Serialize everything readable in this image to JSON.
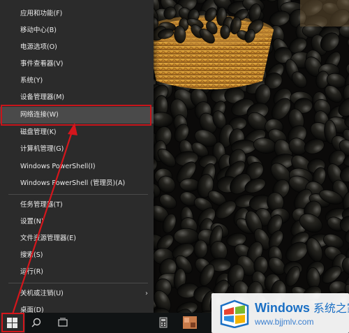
{
  "menu": {
    "items": [
      {
        "label": "应用和功能(F)"
      },
      {
        "label": "移动中心(B)"
      },
      {
        "label": "电源选项(O)"
      },
      {
        "label": "事件查看器(V)"
      },
      {
        "label": "系统(Y)"
      },
      {
        "label": "设备管理器(M)"
      },
      {
        "label": "网络连接(W)",
        "highlighted": true
      },
      {
        "label": "磁盘管理(K)"
      },
      {
        "label": "计算机管理(G)"
      },
      {
        "label": "Windows PowerShell(I)"
      },
      {
        "label": "Windows PowerShell (管理员)(A)"
      },
      {
        "label": "任务管理器(T)"
      },
      {
        "label": "设置(N)"
      },
      {
        "label": "文件资源管理器(E)"
      },
      {
        "label": "搜索(S)"
      },
      {
        "label": "运行(R)"
      },
      {
        "label": "关机或注销(U)",
        "submenu": true
      },
      {
        "label": "桌面(D)"
      }
    ],
    "submenu_arrow": "›"
  },
  "taskbar": {
    "icons": [
      "windows-start-icon",
      "search-icon",
      "task-view-icon",
      "calculator-icon",
      "app-icon"
    ]
  },
  "watermark": {
    "brand": "Windows",
    "brand_cn": "系统之家",
    "url": "www.bjjmlv.com",
    "logo_colors": [
      "#e8432f",
      "#7ab92e",
      "#2d8ee0",
      "#f4b400"
    ]
  },
  "annotation": {
    "color": "#d4161c",
    "icon": "red-arrow-icon"
  }
}
